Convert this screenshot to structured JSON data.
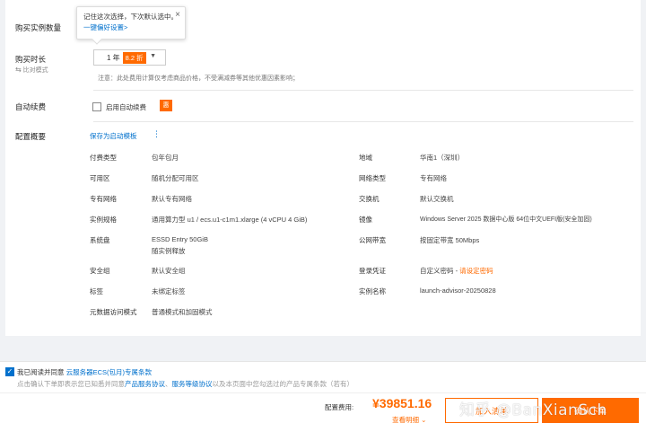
{
  "form": {
    "quantity_label": "购买实例数量",
    "tooltip": {
      "text": "记住这次选择，下次默认选中。",
      "link": "一键偏好设置>",
      "close": "×"
    },
    "duration_label": "购买时长",
    "compare_label": "比对模式",
    "duration_value": "1 年",
    "duration_discount": "8.2 折",
    "duration_note": "注意：此处费用计算仅考虑商品价格，不受满减券等其他优惠因素影响；",
    "autorenew_label": "自动续费",
    "autorenew_option": "启用自动续费",
    "autorenew_tag": "惠",
    "overview_label": "配置概要",
    "save_template": "保存为启动模板"
  },
  "config": [
    {
      "key": "付费类型",
      "value": "包年包月"
    },
    {
      "key": "地域",
      "value": "华南1（深圳）"
    },
    {
      "key": "可用区",
      "value": "随机分配可用区"
    },
    {
      "key": "网络类型",
      "value": "专有网络"
    },
    {
      "key": "专有网络",
      "value": "默认专有网络"
    },
    {
      "key": "交换机",
      "value": "默认交换机"
    },
    {
      "key": "实例规格",
      "value": "通用算力型 u1 / ecs.u1-c1m1.xlarge (4 vCPU 4 GiB)"
    },
    {
      "key": "镜像",
      "value": "Windows Server 2025 数据中心版 64位中文UEFI版(安全加固)"
    },
    {
      "key": "系统盘",
      "value": "ESSD Entry 50GiB",
      "value2": "随实例释放"
    },
    {
      "key": "公网带宽",
      "value": "按固定带宽 50Mbps"
    },
    {
      "key": "安全组",
      "value": "默认安全组"
    },
    {
      "key": "登录凭证",
      "value": "自定义密码 - ",
      "value_highlight": "请设定密码"
    },
    {
      "key": "标签",
      "value": "未绑定标签"
    },
    {
      "key": "实例名称",
      "value": "launch-advisor-20250828"
    },
    {
      "key": "元数据访问模式",
      "value": "普通模式和加固模式"
    }
  ],
  "footer": {
    "agree_prefix": "我已阅读并同意",
    "agree_link": "云服务器ECS(包月)专属条款",
    "notice_prefix": "点击确认下单即表示您已知悉并同意",
    "notice_link1": "产品服务协议",
    "notice_sep": "、",
    "notice_link2": "服务等级协议",
    "notice_suffix": "以及本页面中您勾选过的产品专属条款（若有）",
    "fee_label": "配置费用:",
    "price": "¥39851.16",
    "detail_link": "查看明细",
    "cart_button": "加入清单",
    "buy_button": "确认下单",
    "watermark": "知乎 @BanXianSch"
  },
  "colors": {
    "accent": "#ff6a00",
    "link": "#0070cc"
  }
}
